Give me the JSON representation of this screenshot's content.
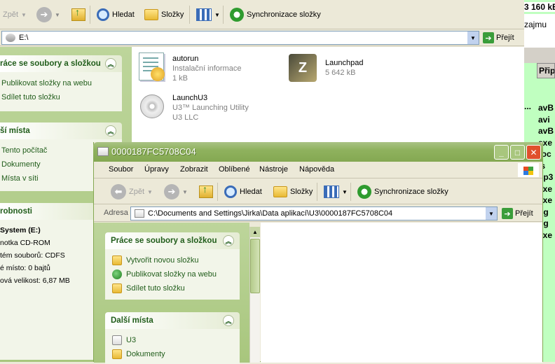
{
  "back_window": {
    "toolbar": {
      "back_label": "Zpět",
      "search_label": "Hledat",
      "folders_label": "Složky",
      "sync_label": "Synchronizace složky"
    },
    "address": {
      "value": "E:\\",
      "go_label": "Přejít"
    },
    "tasks_panel": {
      "title": "ráce se soubory a složkou",
      "items": [
        "Publikovat složky na webu",
        "Sdílet tuto složku"
      ]
    },
    "places_panel": {
      "title": "ší místa",
      "items": [
        "Tento počítač",
        "Dokumenty",
        "Místa v síti"
      ]
    },
    "details_panel": {
      "title": "robnosti",
      "name": "System (E:)",
      "type": "notka CD-ROM",
      "fs": "tém souborů: CDFS",
      "free": "é místo: 0 bajtů",
      "total": "ová velikost: 6,87 MB"
    },
    "files": [
      {
        "name": "autorun",
        "sub1": "Instalační informace",
        "sub2": "1 kB",
        "icon": "inf-file-icon"
      },
      {
        "name": "Launchpad",
        "sub1": "5 642 kB",
        "sub2": "",
        "icon": "launchpad-exe-icon"
      },
      {
        "name": "LaunchU3",
        "sub1": "U3™ Launching Utility",
        "sub2": "U3 LLC",
        "icon": "cd-icon"
      }
    ]
  },
  "right_edge": {
    "top_text": "3 160 kB",
    "zajmu": "zajmu",
    "col_header": "Přip",
    "items": [
      "avB",
      "avi",
      "avB",
      "exe",
      "roc",
      "ls",
      "np3",
      "exe",
      "exe",
      "pg",
      "pg",
      "exe"
    ],
    "dots": "..."
  },
  "front_window": {
    "title": "0000187FC5708C04",
    "menu": [
      "Soubor",
      "Úpravy",
      "Zobrazit",
      "Oblíbené",
      "Nástroje",
      "Nápověda"
    ],
    "toolbar": {
      "back_label": "Zpět",
      "search_label": "Hledat",
      "folders_label": "Složky",
      "sync_label": "Synchronizace složky"
    },
    "address": {
      "label": "Adresa",
      "value": "C:\\Documents and Settings\\Jirka\\Data aplikací\\U3\\0000187FC5708C04",
      "go_label": "Přejít"
    },
    "tasks_panel": {
      "title": "Práce se soubory a složkou",
      "items": [
        "Vytvořit novou složku",
        "Publikovat složky na webu",
        "Sdílet tuto složku"
      ]
    },
    "places_panel": {
      "title": "Další místa",
      "items": [
        "U3",
        "Dokumenty"
      ]
    }
  }
}
